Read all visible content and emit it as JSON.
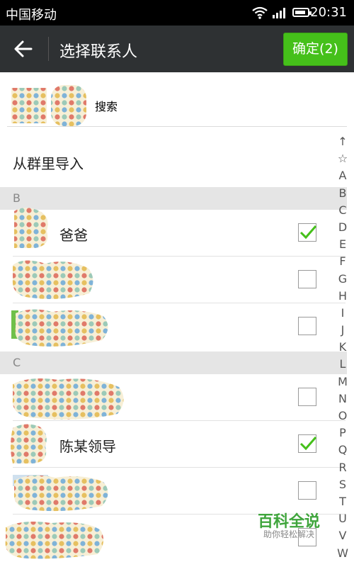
{
  "status": {
    "carrier": "中国移动",
    "time": "20:31"
  },
  "header": {
    "title": "选择联系人",
    "confirm_label": "确定(2)"
  },
  "search": {
    "placeholder": "搜索"
  },
  "group_import_label": "从群里导入",
  "sections": [
    {
      "letter": "B",
      "contacts": [
        {
          "name": "爸爸",
          "checked": true
        },
        {
          "name": "",
          "checked": false
        },
        {
          "name": "",
          "checked": false
        }
      ]
    },
    {
      "letter": "C",
      "contacts": [
        {
          "name": "",
          "checked": false
        },
        {
          "name": "陈某领导",
          "checked": true
        },
        {
          "name": "",
          "checked": false
        },
        {
          "name": "",
          "checked": false
        }
      ]
    }
  ],
  "index_letters": [
    "↑",
    "☆",
    "A",
    "B",
    "C",
    "D",
    "E",
    "F",
    "G",
    "H",
    "I",
    "J",
    "K",
    "L",
    "M",
    "N",
    "O",
    "P",
    "Q",
    "R",
    "S",
    "T",
    "U",
    "V",
    "W"
  ],
  "watermark": {
    "title": "百科全说",
    "subtitle": "助你轻松解决"
  },
  "colors": {
    "accent": "#45c01a",
    "appbar": "#2e3133",
    "section_bg": "#e5e5e5"
  }
}
